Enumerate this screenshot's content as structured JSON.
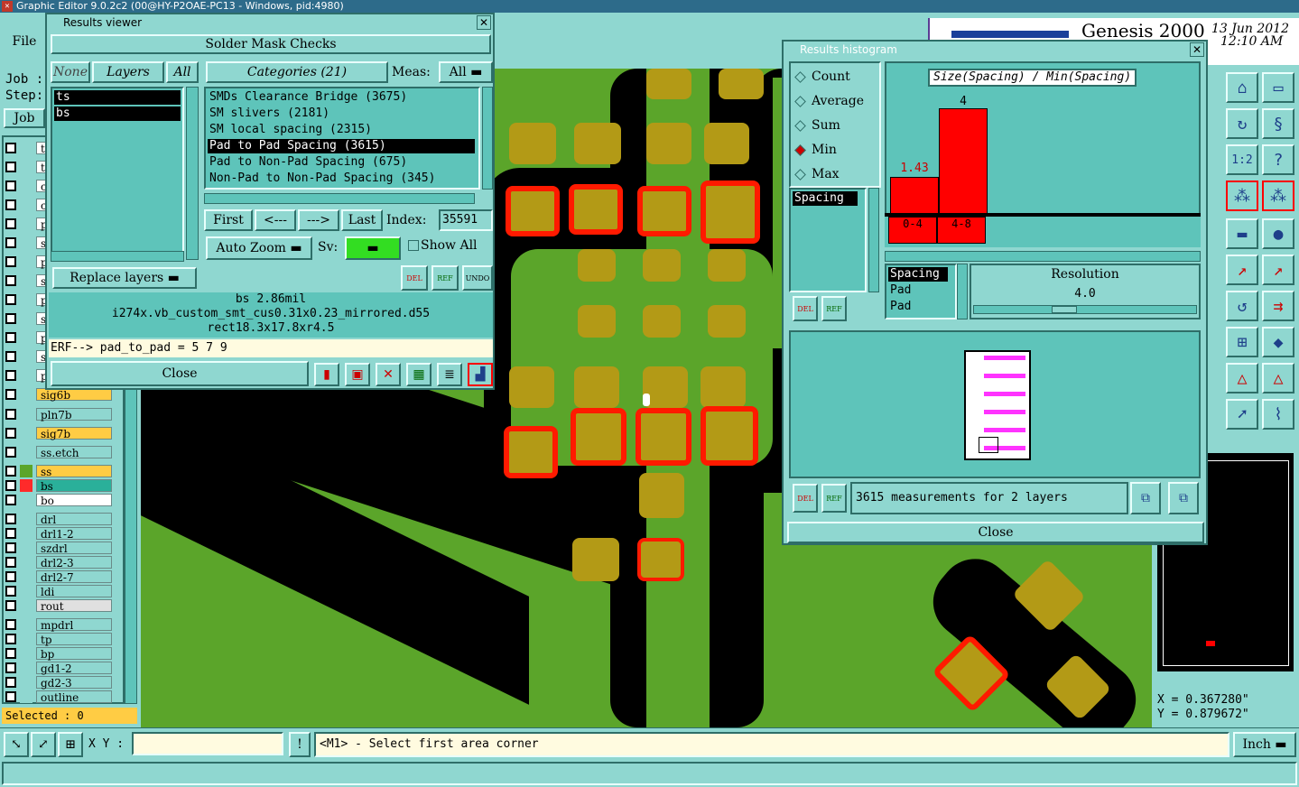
{
  "window_title": "Graphic Editor 9.0.2c2 (00@HY-P2OAE-PC13 - Windows, pid:4980)",
  "menu": {
    "file": "File"
  },
  "header": {
    "brand": "Genesis 2000",
    "date": "13 Jun 2012",
    "time": "12:10 AM"
  },
  "left": {
    "job_label": "Job :",
    "step_label": "Step:",
    "job_button": "Job",
    "selected": "Selected : 0",
    "layers": [
      {
        "name": "t",
        "color": "#ffffff"
      },
      {
        "name": "t",
        "color": "#ffffff"
      },
      {
        "name": "c",
        "color": "#ffffff"
      },
      {
        "name": "c",
        "color": "#ffffff"
      },
      {
        "name": "p",
        "color": "#ffffff"
      },
      {
        "name": "s",
        "color": "#ffffff"
      },
      {
        "name": "p",
        "color": "#ffffff"
      },
      {
        "name": "s",
        "color": "#ffffff"
      },
      {
        "name": "p",
        "color": "#ffffff"
      },
      {
        "name": "s",
        "color": "#ffffff"
      },
      {
        "name": "p",
        "color": "#ffffff"
      },
      {
        "name": "s",
        "color": "#ffffff"
      },
      {
        "name": "p",
        "color": "#ffffff"
      },
      {
        "name": "sig6b",
        "color": "#ffcc44"
      },
      {
        "name": "pln7b",
        "color": "#8fd7d0"
      },
      {
        "name": "sig7b",
        "color": "#ffcc44"
      },
      {
        "name": "ss.etch",
        "color": "#8fd7d0"
      },
      {
        "name": "ss",
        "color": "#ffcc44"
      },
      {
        "name": "bs",
        "color": "#2ab09a"
      },
      {
        "name": "bo",
        "color": "#ffffff"
      },
      {
        "name": "drl",
        "color": "#8fd7d0"
      },
      {
        "name": "drl1-2",
        "color": "#8fd7d0"
      },
      {
        "name": "szdrl",
        "color": "#8fd7d0"
      },
      {
        "name": "drl2-3",
        "color": "#8fd7d0"
      },
      {
        "name": "drl2-7",
        "color": "#8fd7d0"
      },
      {
        "name": "ldi",
        "color": "#8fd7d0"
      },
      {
        "name": "rout",
        "color": "#e0e0e0"
      },
      {
        "name": "mpdrl",
        "color": "#8fd7d0"
      },
      {
        "name": "tp",
        "color": "#8fd7d0"
      },
      {
        "name": "bp",
        "color": "#8fd7d0"
      },
      {
        "name": "gd1-2",
        "color": "#8fd7d0"
      },
      {
        "name": "gd2-3",
        "color": "#8fd7d0"
      },
      {
        "name": "outline",
        "color": "#8fd7d0"
      }
    ]
  },
  "results_viewer": {
    "title": "Results viewer",
    "heading": "Solder Mask Checks",
    "none_tab": "None",
    "layers_tab": "Layers",
    "all_tab": "All",
    "layers_list": [
      "ts",
      "bs"
    ],
    "categories_label": "Categories (21)",
    "meas_label": "Meas:",
    "meas_value": "All",
    "categories": [
      "SMDs Clearance Bridge (3675)",
      "SM slivers (2181)",
      "SM local spacing (2315)",
      "Pad to Pad Spacing (3615)",
      "Pad to Non-Pad Spacing (675)",
      "Non-Pad to Non-Pad Spacing (345)"
    ],
    "selected_category_index": 3,
    "first": "First",
    "prev": "<---",
    "next": "--->",
    "last": "Last",
    "index_label": "Index:",
    "index_value": "35591",
    "auto_zoom": "Auto Zoom",
    "sv_label": "Sv:",
    "show_all": "Show All",
    "replace_layers": "Replace layers",
    "del": "DEL",
    "ref": "REF",
    "undo": "UNDO",
    "info_line1": "bs 2.86mil",
    "info_line2": "i274x.vb_custom_smt_cus0.31x0.23_mirrored.d55",
    "info_line3": "rect18.3x17.8xr4.5",
    "erf": "ERF--> pad_to_pad = 5 7 9",
    "close": "Close"
  },
  "histogram": {
    "title": "Results histogram",
    "modes": [
      "Count",
      "Average",
      "Sum",
      "Min",
      "Max"
    ],
    "selected_mode": "Min",
    "chart_title": "Size(Spacing) / Min(Spacing)",
    "param_list": [
      "Spacing"
    ],
    "bins": [
      "0-4",
      "4-8"
    ],
    "bar_labels": [
      "1.43",
      "4"
    ],
    "attr_list": [
      "Spacing",
      "Pad",
      "Pad"
    ],
    "resolution_label": "Resolution",
    "resolution_value": "4.0",
    "summary": "3615 measurements for 2 layers",
    "close": "Close",
    "del": "DEL",
    "ref": "REF"
  },
  "chart_data": {
    "type": "bar",
    "title": "Size(Spacing) / Min(Spacing)",
    "categories": [
      "0-4",
      "4-8"
    ],
    "values": [
      1.43,
      4
    ],
    "colors": [
      "#ff0000"
    ]
  },
  "coords": {
    "x": "X = 0.367280\"",
    "y": "Y = 0.879672\""
  },
  "status": {
    "xy_label": "X Y :",
    "xy_value": "",
    "message": "<M1> - Select first area corner",
    "unit": "Inch"
  }
}
